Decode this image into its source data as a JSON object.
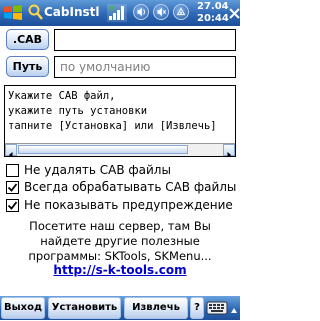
{
  "titlebar": {
    "title": "CabInstl",
    "clock_time": "20:44",
    "clock_date": "27.04",
    "icons": [
      "windows-start-icon",
      "app-icon",
      "signal-strength-icon",
      "volume-icon",
      "volume-mute-icon",
      "connectivity-icon",
      "close-icon"
    ]
  },
  "form": {
    "cab_button_label": ".CAB",
    "cab_field_value": "",
    "path_button_label": "Путь",
    "path_field_placeholder": "по умолчанию",
    "instructions_text": "Укажите CAB файл,\nукажите путь установки\nтапните [Установка] или [Извлечь]",
    "options": [
      {
        "label": "Не удалять CAB файлы",
        "checked": false
      },
      {
        "label": "Всегда обрабатывать CAB файлы",
        "checked": true
      },
      {
        "label": "Не показывать предупреждение",
        "checked": true
      }
    ],
    "info_text": "Посетите наш сервер, там Вы найдете другие полезные программы: SKTools, SKMenu...",
    "link_text": "http://s-k-tools.com"
  },
  "menubar": {
    "exit_label": "Выход",
    "install_label": "Установить",
    "extract_label": "Извлечь",
    "help_label": "?"
  },
  "colors": {
    "titlebar": "#2c66b4",
    "menubar": "#2e68b6",
    "link": "#0000cc",
    "button_border": "#5b7fbf"
  }
}
